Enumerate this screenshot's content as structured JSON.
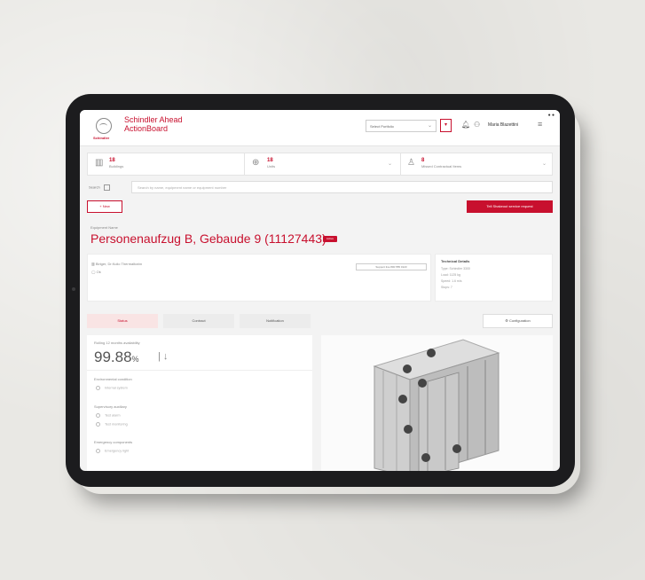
{
  "app": {
    "brand_logo_text": "Schindler",
    "title_line1": "Schindler Ahead",
    "title_line2": "ActionBoard"
  },
  "header": {
    "site_select": "Select Portfolio",
    "user_name": "Maria Blazettini"
  },
  "stats": [
    {
      "value": "18",
      "label": "Buildings"
    },
    {
      "value": "18",
      "label": "Units"
    },
    {
      "value": "8",
      "label": "Missed Contractual Items"
    }
  ],
  "search": {
    "label": "Search",
    "placeholder": "Search by name, equipment name or equipment number"
  },
  "actions": {
    "new_label": "+ New",
    "service_label": "Tell Shakeout service request"
  },
  "equipment": {
    "label": "Equipment Name",
    "title": "Personenaufzug B, Gebaude 9 (11127443)",
    "badge": "Active",
    "address": "Biriger, Dr.Kulio Thermalbahn",
    "status": "Ok",
    "support_button": "Support line 800 555 0123"
  },
  "technical": {
    "title": "Technical Details",
    "lines": [
      "Type: Schindler 3300",
      "Load: 1125 kg",
      "Speed: 1.6 m/s",
      "Stops: 7"
    ]
  },
  "tabs": [
    "Status",
    "Contract",
    "Notification"
  ],
  "configuration_label": "Configuration",
  "availability": {
    "label": "Rolling 12 months availability",
    "value": "99.88",
    "unit": "%"
  },
  "sections": [
    {
      "title": "Environmental condition",
      "items": [
        "Internal system"
      ]
    },
    {
      "title": "Supervisory auxiliary",
      "items": [
        "Test alarm",
        "Test monitoring"
      ]
    },
    {
      "title": "Emergency components",
      "items": [
        "Emergency light"
      ]
    }
  ],
  "colors": {
    "accent": "#c8102e"
  }
}
